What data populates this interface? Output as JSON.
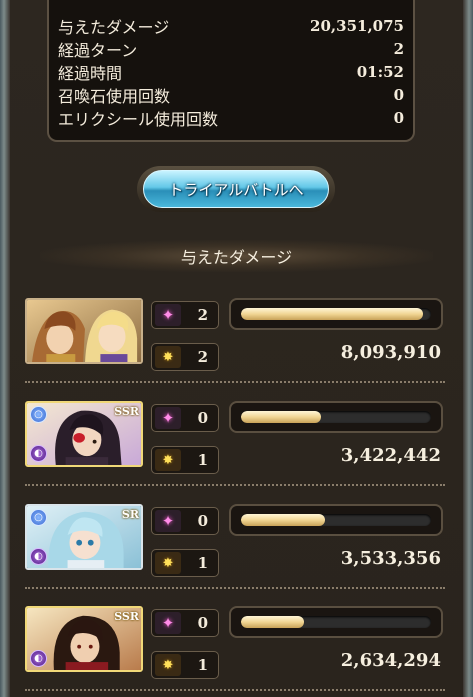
{
  "stats": [
    {
      "label": "与えたダメージ",
      "value": "20,351,075"
    },
    {
      "label": "経過ターン",
      "value": "2"
    },
    {
      "label": "経過時間",
      "value": "01:52"
    },
    {
      "label": "召喚石使用回数",
      "value": "0"
    },
    {
      "label": "エリクシール使用回数",
      "value": "0"
    }
  ],
  "trial_button_label": "トライアルバトルへ",
  "section_title": "与えたダメージ",
  "characters": [
    {
      "portrait": "main-character-duo",
      "rarity": "",
      "skill_count": "2",
      "ougi_count": "2",
      "damage": "8,093,910",
      "bar_fill": 0.96
    },
    {
      "portrait": "ssr-dark-character",
      "rarity": "SSR",
      "skill_count": "0",
      "ougi_count": "1",
      "damage": "3,422,442",
      "bar_fill": 0.42
    },
    {
      "portrait": "sr-character",
      "rarity": "SR",
      "skill_count": "0",
      "ougi_count": "1",
      "damage": "3,533,356",
      "bar_fill": 0.44
    },
    {
      "portrait": "ssr-dark-character-2",
      "rarity": "SSR",
      "skill_count": "0",
      "ougi_count": "1",
      "damage": "2,634,294",
      "bar_fill": 0.33
    }
  ],
  "icons": {
    "skill": "sparkle-icon",
    "ougi": "ougi-burst-icon"
  },
  "colors": {
    "bar_fill": "#f1d694",
    "button": "#63c8e8",
    "panel": "#2a241d"
  }
}
